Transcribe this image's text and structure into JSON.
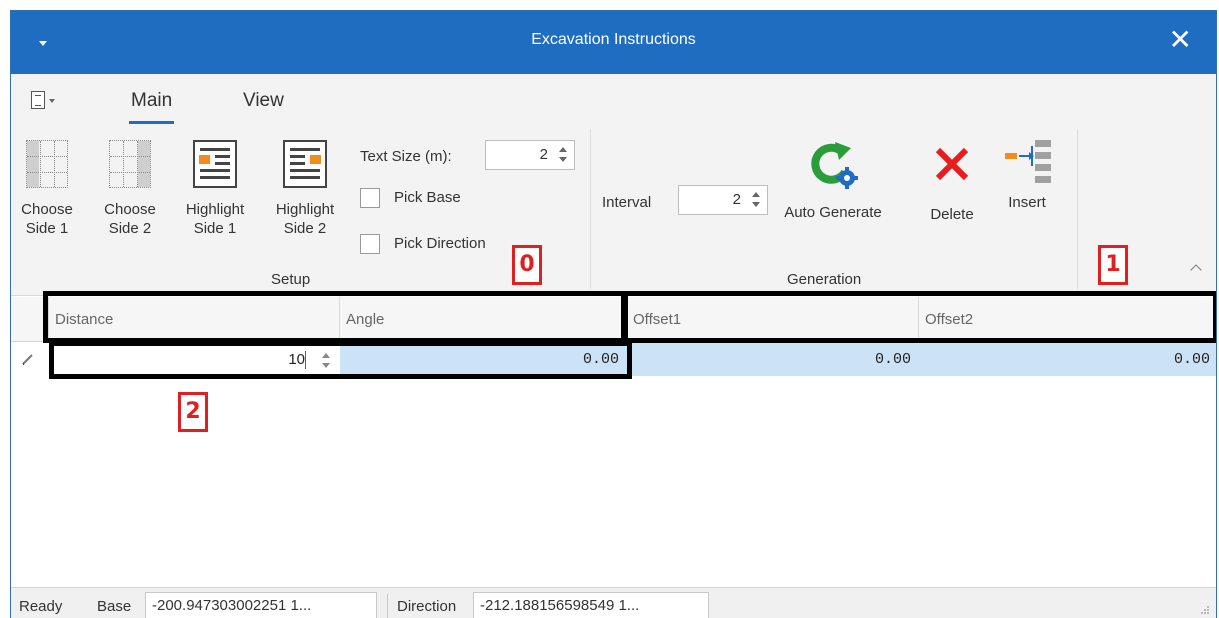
{
  "window": {
    "title": "Excavation Instructions",
    "close_glyph": "✕"
  },
  "ribbon": {
    "tabs": [
      {
        "label": "Main",
        "active": true
      },
      {
        "label": "View",
        "active": false
      }
    ],
    "setup": {
      "choose_side1": [
        "Choose",
        "Side 1"
      ],
      "choose_side2": [
        "Choose",
        "Side 2"
      ],
      "highlight_side1": [
        "Highlight",
        "Side 1"
      ],
      "highlight_side2": [
        "Highlight",
        "Side 2"
      ],
      "text_size_label": "Text Size (m):",
      "text_size_value": "2",
      "pick_base": "Pick Base",
      "pick_direction": "Pick Direction",
      "group_label": "Setup"
    },
    "generation": {
      "interval_label": "Interval",
      "interval_value": "2",
      "auto_generate": "Auto Generate",
      "delete": "Delete",
      "insert": "Insert",
      "group_label": "Generation"
    }
  },
  "grid": {
    "columns": [
      "Distance",
      "Angle",
      "Offset1",
      "Offset2"
    ],
    "rows": [
      {
        "distance": "10",
        "angle": "0.00",
        "offset1": "0.00",
        "offset2": "0.00"
      }
    ]
  },
  "annotations": {
    "badge0": "0",
    "badge1": "1",
    "badge2": "2"
  },
  "status": {
    "ready": "Ready",
    "base_label": "Base",
    "base_value": "-200.947303002251 1...",
    "direction_label": "Direction",
    "direction_value": "-212.188156598549 1..."
  },
  "colors": {
    "titlebar": "#1f6dc1",
    "accent_orange": "#f28c1c",
    "delete_red": "#e81e1e",
    "refresh_green": "#2a9d3a",
    "selection": "#cce3f7",
    "badge_red": "#e02020"
  }
}
